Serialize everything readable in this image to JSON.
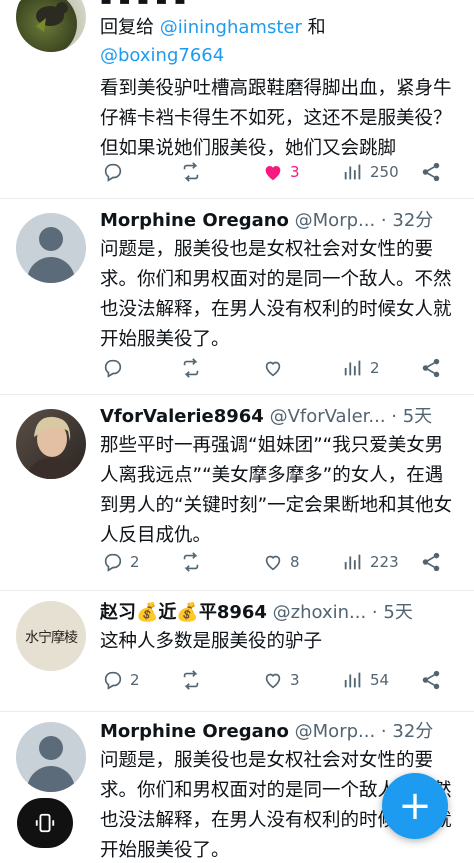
{
  "tweets": [
    {
      "reply_prefix": "回复给 ",
      "reply_mention_1": "@iininghamster",
      "reply_and": " 和",
      "reply_mention_2": "@boxing7664",
      "text": "看到美役驴吐槽高跟鞋磨得脚出血，紧身牛仔裤卡裆卡得生不如死，这还不是服美役？但如果说她们服美役，她们又会跳脚",
      "replies": "",
      "retweets": "",
      "likes": "3",
      "views": "250",
      "liked": true
    },
    {
      "name": "Morphine Oregano",
      "handle": "@Morp...",
      "time": " · 32分",
      "text": "问题是，服美役也是女权社会对女性的要求。你们和男权面对的是同一个敌人。不然也没法解释，在男人没有权利的时候女人就开始服美役了。",
      "replies": "",
      "retweets": "",
      "likes": "",
      "views": "2"
    },
    {
      "name": "VforValerie8964",
      "handle": "@VforValer...",
      "time": " · 5天",
      "text": "那些平时一再强调“姐妹团”“我只爱美女男人离我远点”“美女摩多摩多”的女人，在遇到男人的“关键时刻”一定会果断地和其他女人反目成仇。",
      "replies": "2",
      "retweets": "",
      "likes": "8",
      "views": "223"
    },
    {
      "name": "赵习💰近💰平8964",
      "handle": "@zhoxin...",
      "time": " · 5天",
      "text": "这种人多数是服美役的驴子",
      "replies": "2",
      "retweets": "",
      "likes": "3",
      "views": "54",
      "avatar_text": "水宁摩棱"
    },
    {
      "name": "Morphine Oregano",
      "handle": "@Morp...",
      "time": " · 32分",
      "text": "问题是，服美役也是女权社会对女性的要求。你们和男权面对的是同一个敌人。不然也没法解释，在男人没有权利的时候女人就开始服美役了。"
    }
  ],
  "fab_label": "+",
  "icons": {
    "reply": "reply-icon",
    "retweet": "retweet-icon",
    "like": "heart-icon",
    "views": "views-icon",
    "share": "share-icon",
    "more": "more-icon",
    "compose": "compose-icon"
  },
  "colors": {
    "accent": "#1d9bf0",
    "like": "#f91880",
    "muted": "#536471"
  }
}
